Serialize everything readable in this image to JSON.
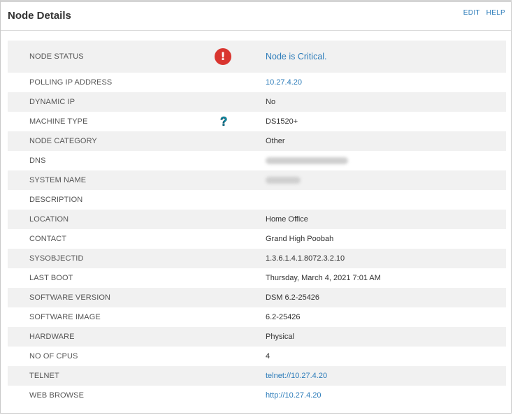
{
  "panel": {
    "title": "Node Details",
    "edit_label": "EDIT",
    "help_label": "HELP"
  },
  "status": {
    "label": "NODE STATUS",
    "value": "Node is Critical.",
    "icon": "critical-status-icon",
    "icon_color": "#d9352f"
  },
  "rows": [
    {
      "label": "POLLING IP ADDRESS",
      "value": "10.27.4.20",
      "link": true
    },
    {
      "label": "DYNAMIC IP",
      "value": "No"
    },
    {
      "label": "MACHINE TYPE",
      "value": "DS1520+",
      "icon": "help-question-icon"
    },
    {
      "label": "NODE CATEGORY",
      "value": "Other"
    },
    {
      "label": "DNS",
      "value": "",
      "redacted": true
    },
    {
      "label": "SYSTEM NAME",
      "value": "",
      "redacted": true
    },
    {
      "label": "DESCRIPTION",
      "value": ""
    },
    {
      "label": "LOCATION",
      "value": "Home Office"
    },
    {
      "label": "CONTACT",
      "value": "Grand High Poobah"
    },
    {
      "label": "SYSOBJECTID",
      "value": "1.3.6.1.4.1.8072.3.2.10"
    },
    {
      "label": "LAST BOOT",
      "value": "Thursday, March 4, 2021 7:01 AM"
    },
    {
      "label": "SOFTWARE VERSION",
      "value": "DSM 6.2-25426"
    },
    {
      "label": "SOFTWARE IMAGE",
      "value": "6.2-25426"
    },
    {
      "label": "HARDWARE",
      "value": "Physical"
    },
    {
      "label": "NO OF CPUS",
      "value": "4"
    },
    {
      "label": "TELNET",
      "value": "telnet://10.27.4.20",
      "link": true
    },
    {
      "label": "WEB BROWSE",
      "value": "http://10.27.4.20",
      "link": true
    }
  ],
  "colors": {
    "link": "#2b7bb9",
    "alt_row": "#f1f1f1"
  }
}
